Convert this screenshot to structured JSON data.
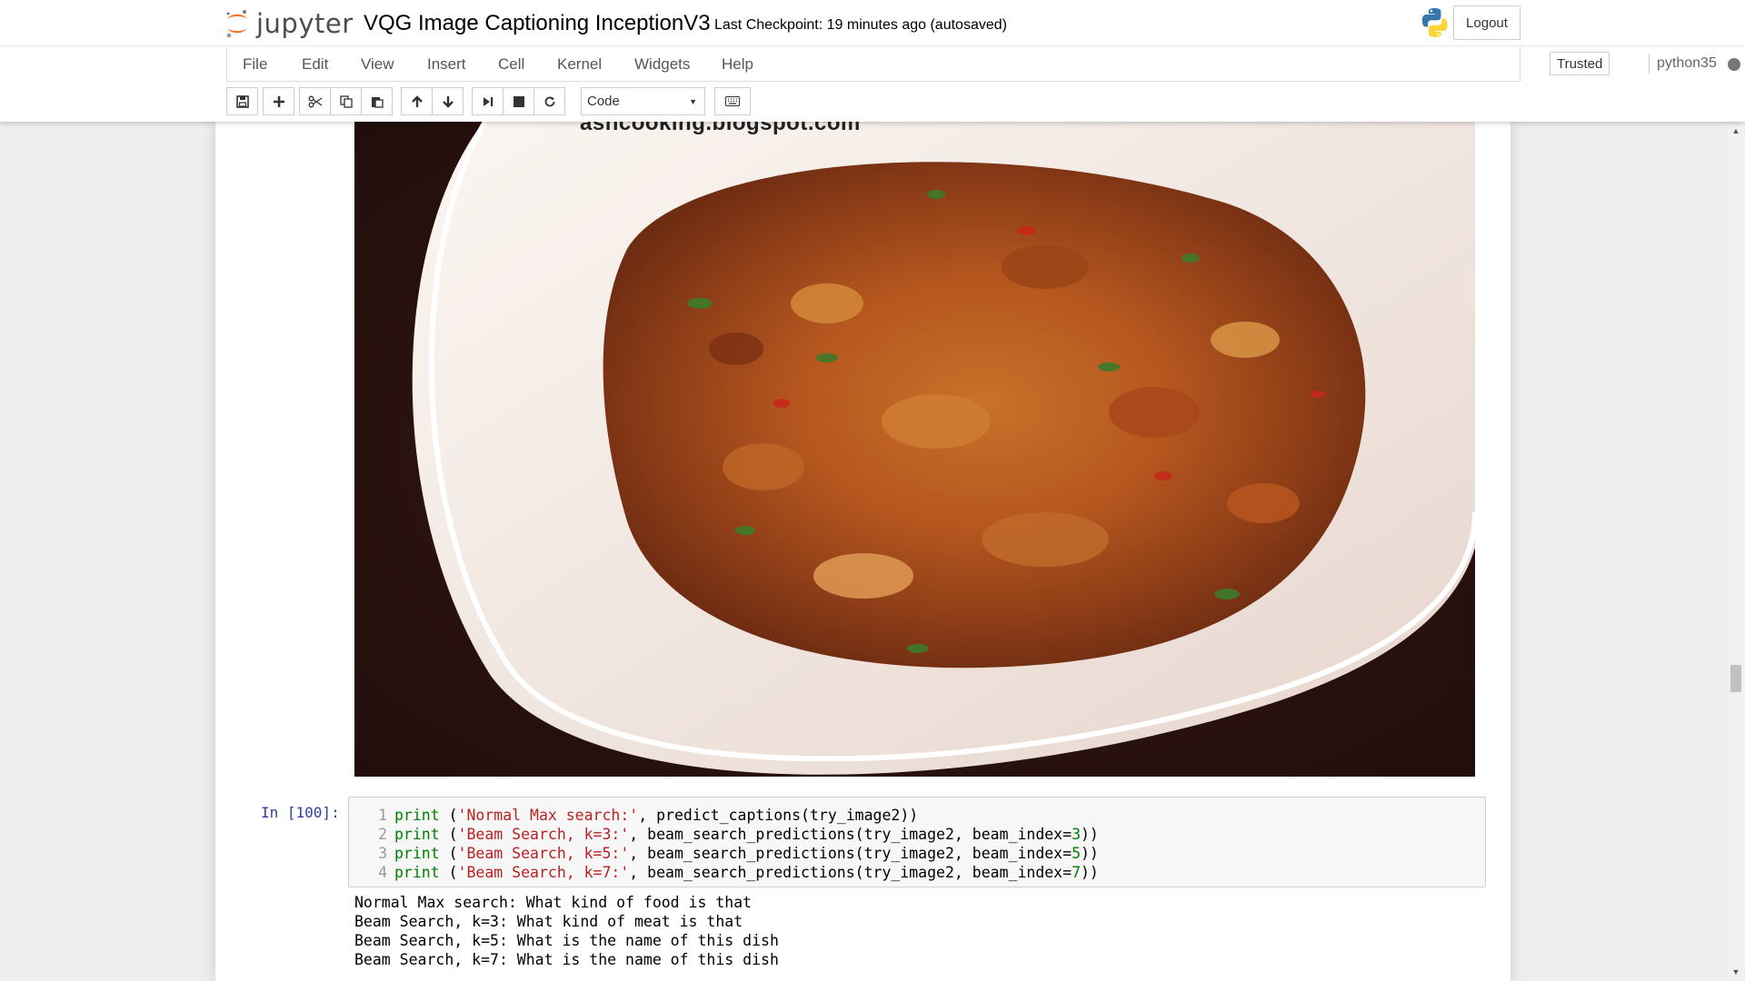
{
  "header": {
    "logo_text": "jupyter",
    "notebook_title": "VQG Image Captioning InceptionV3",
    "checkpoint": "Last Checkpoint: 19 minutes ago (autosaved)",
    "logout_label": "Logout"
  },
  "menubar": {
    "items": [
      "File",
      "Edit",
      "View",
      "Insert",
      "Cell",
      "Kernel",
      "Widgets",
      "Help"
    ],
    "trusted_label": "Trusted",
    "kernel_name": "python35"
  },
  "toolbar": {
    "icons": [
      "save-icon",
      "plus-icon",
      "cut-icon",
      "copy-icon",
      "paste-icon",
      "arrow-up-icon",
      "arrow-down-icon",
      "run-icon",
      "stop-icon",
      "restart-icon",
      "keyboard-icon"
    ],
    "cell_type": "Code"
  },
  "image": {
    "watermark": "ashcooking.blogspot.com"
  },
  "cell": {
    "prompt": "In [100]:",
    "line_numbers": [
      "1",
      "2",
      "3",
      "4"
    ],
    "lines": [
      {
        "kw": "print",
        "a": " (",
        "str": "'Normal Max search:'",
        "b": ", predict_captions(try_image2))",
        "num": "",
        "c": ""
      },
      {
        "kw": "print",
        "a": " (",
        "str": "'Beam Search, k=3:'",
        "b": ", beam_search_predictions(try_image2, beam_index=",
        "num": "3",
        "c": "))"
      },
      {
        "kw": "print",
        "a": " (",
        "str": "'Beam Search, k=5:'",
        "b": ", beam_search_predictions(try_image2, beam_index=",
        "num": "5",
        "c": "))"
      },
      {
        "kw": "print",
        "a": " (",
        "str": "'Beam Search, k=7:'",
        "b": ", beam_search_predictions(try_image2, beam_index=",
        "num": "7",
        "c": "))"
      }
    ]
  },
  "output": {
    "lines": [
      "Normal Max search: What kind of food is that",
      "Beam Search, k=3: What kind of meat is that",
      "Beam Search, k=5: What is the name of this dish",
      "Beam Search, k=7: What is the name of this dish"
    ]
  }
}
